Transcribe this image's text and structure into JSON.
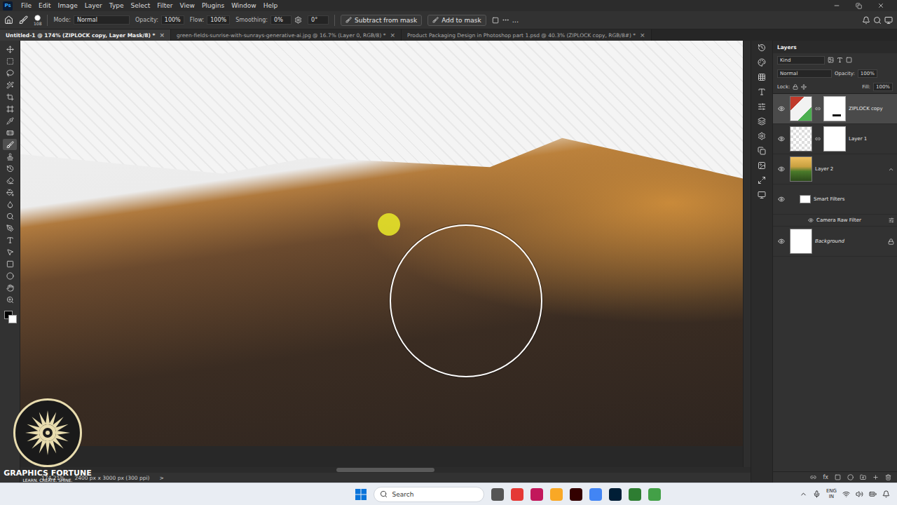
{
  "app_logo": "Ps",
  "menu": [
    "File",
    "Edit",
    "Image",
    "Layer",
    "Type",
    "Select",
    "Filter",
    "View",
    "Plugins",
    "Window",
    "Help"
  ],
  "options": {
    "brush_size": "108",
    "mode_label": "Mode:",
    "mode": "Normal",
    "opacity_label": "Opacity:",
    "opacity": "100%",
    "flow_label": "Flow:",
    "flow": "100%",
    "smoothing_label": "Smoothing:",
    "smoothing": "0%",
    "angle": "0°",
    "buttons": [
      "Subtract from mask",
      "Add to mask"
    ],
    "more": "..."
  },
  "doc_tabs": [
    {
      "label": "Untitled-1 @ 174% (ZIPLOCK copy, Layer Mask/8) *",
      "selected": true
    },
    {
      "label": "green-fields-sunrise-with-sunrays-generative-ai.jpg @ 16.7% (Layer 0, RGB/8) *",
      "selected": false
    },
    {
      "label": "Product Packaging Design in Photoshop part 1.psd @ 40.3% (ZIPLOCK copy, RGB/8#) *",
      "selected": false
    }
  ],
  "close_glyph": "×",
  "tools": [
    {
      "selected": false
    },
    {
      "selected": false
    },
    {
      "selected": false
    },
    {
      "selected": false
    },
    {
      "selected": false
    },
    {
      "selected": false
    },
    {
      "selected": false
    },
    {
      "selected": false
    },
    {
      "selected": true
    },
    {
      "selected": false
    },
    {
      "selected": false
    },
    {
      "selected": false
    },
    {
      "selected": false
    },
    {
      "selected": false
    },
    {
      "selected": false
    },
    {
      "selected": false
    },
    {
      "selected": false
    },
    {
      "selected": false
    },
    {
      "selected": false
    },
    {
      "selected": false
    },
    {
      "selected": false
    },
    {
      "selected": false
    }
  ],
  "watermark": {
    "title": "GRAPHICS FORTUNE",
    "tagline": "LEARN. CREATE. SHINE."
  },
  "status_bar": {
    "zoom": "174.21%",
    "size": "2400 px x 3000 px (300 ppi)",
    "arrow": ">"
  },
  "layers_panel": {
    "title": "Layers",
    "filter": "Kind",
    "blend": "Normal",
    "opacity_label": "Opacity:",
    "opacity": "100%",
    "lock_label": "Lock:",
    "fill_label": "Fill:",
    "fill": "100%",
    "footer_fx": "fx",
    "layers": [
      {
        "name": "ZIPLOCK copy",
        "kind": "layer",
        "visible": true,
        "selected": true,
        "thumb": "package",
        "mask": true,
        "locked": false
      },
      {
        "name": "Layer 1",
        "kind": "layer",
        "visible": true,
        "selected": false,
        "thumb": "transparent",
        "mask": true,
        "locked": false
      },
      {
        "name": "Layer 2",
        "kind": "layer",
        "visible": true,
        "selected": false,
        "thumb": "landscape",
        "mask": false,
        "locked": false
      },
      {
        "name": "Smart Filters",
        "kind": "smart-filters",
        "visible": true,
        "selected": false,
        "thumb": "white",
        "mask": false,
        "locked": false
      },
      {
        "name": "Camera Raw Filter",
        "kind": "filter",
        "visible": true,
        "selected": false,
        "thumb": "none",
        "mask": false,
        "locked": false
      },
      {
        "name": "Background",
        "kind": "layer",
        "visible": true,
        "selected": false,
        "thumb": "white",
        "mask": false,
        "locked": true
      }
    ]
  },
  "taskbar": {
    "search": "Search",
    "lang": "ENG",
    "region": "IN"
  }
}
